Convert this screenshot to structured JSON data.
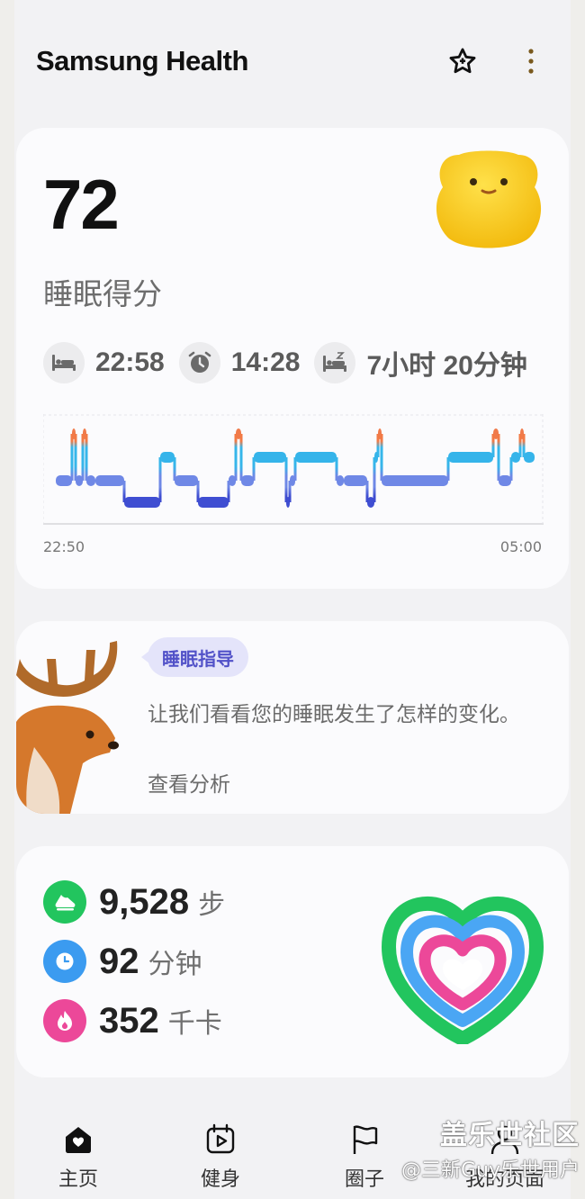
{
  "header": {
    "title": "Samsung Health"
  },
  "sleep": {
    "score": "72",
    "score_label": "睡眠得分",
    "bedtime": "22:58",
    "wake_time": "14:28",
    "duration": "7小时 20分钟",
    "chart": {
      "start_label": "22:50",
      "end_label": "05:00",
      "stage_colors": {
        "awake": "#f07a4a",
        "rem": "#35b4ea",
        "light": "#6f88e6",
        "deep": "#3f4ed2"
      }
    }
  },
  "coach": {
    "badge": "睡眠指导",
    "text": "让我们看看您的睡眠发生了怎样的变化。",
    "link": "查看分析"
  },
  "activity": {
    "steps": {
      "value": "9,528",
      "unit": "步",
      "color": "#22c55e"
    },
    "active_minutes": {
      "value": "92",
      "unit": "分钟",
      "color": "#3b9bf0"
    },
    "calories": {
      "value": "352",
      "unit": "千卡",
      "color": "#ec4899"
    }
  },
  "nav": {
    "home": "主页",
    "fitness": "健身",
    "together": "圈子",
    "my_page": "我的页面"
  },
  "watermark": {
    "line1": "盖乐世社区",
    "line2": "@三新Guy乐世用户"
  }
}
